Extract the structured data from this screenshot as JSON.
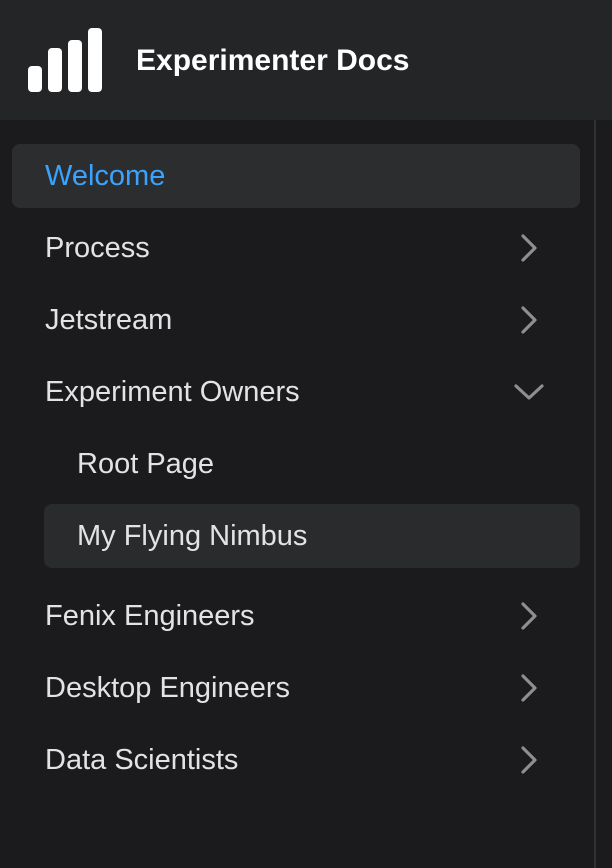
{
  "header": {
    "title": "Experimenter Docs",
    "logo_icon": "bar-chart-logo-icon"
  },
  "colors": {
    "background": "#1b1b1d",
    "header": "#242526",
    "active_text": "#3aa2ff",
    "text": "#e3e3e3"
  },
  "nav": {
    "welcome": "Welcome",
    "process": "Process",
    "jetstream": "Jetstream",
    "experiment_owners": "Experiment Owners",
    "root_page": "Root Page",
    "my_flying_nimbus": "My Flying Nimbus",
    "fenix_engineers": "Fenix Engineers",
    "desktop_engineers": "Desktop Engineers",
    "data_scientists": "Data Scientists"
  }
}
